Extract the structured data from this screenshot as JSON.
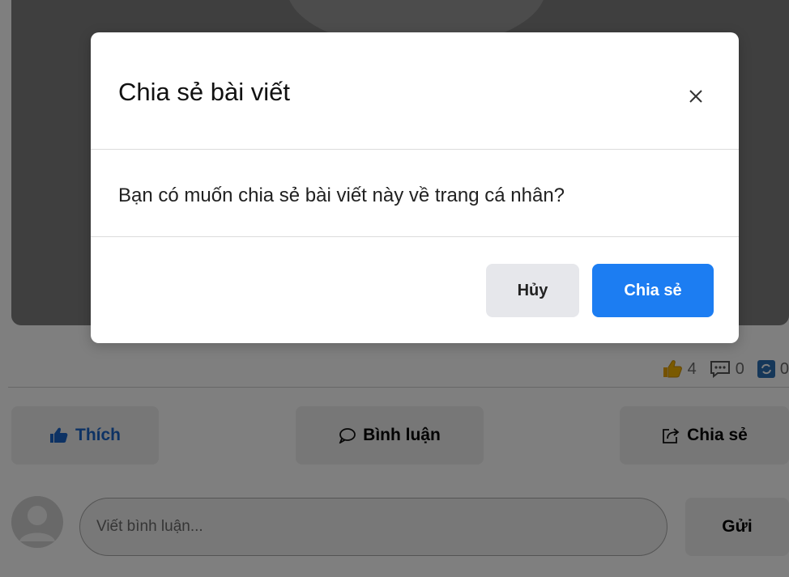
{
  "post": {
    "stats": {
      "likes": "4",
      "comments": "0",
      "shares": "0"
    },
    "actions": {
      "like_label": "Thích",
      "comment_label": "Bình luận",
      "share_label": "Chia sẻ"
    },
    "comment_box": {
      "placeholder": "Viết bình luận...",
      "value": "",
      "send_label": "Gửi"
    }
  },
  "modal": {
    "title": "Chia sẻ bài viết",
    "message": "Bạn có muốn chia sẻ bài viết này về trang cá nhân?",
    "cancel_label": "Hủy",
    "confirm_label": "Chia sẻ"
  },
  "icons": {
    "like_stat": "thumbs-up-icon",
    "comment_stat": "comment-icon",
    "share_stat": "share-icon",
    "like_action": "thumbs-up-icon",
    "comment_action": "speech-bubble-icon",
    "share_action": "share-arrow-icon",
    "close": "close-icon",
    "avatar": "default-avatar-icon"
  },
  "colors": {
    "primary": "#1c7df2",
    "like_text": "#1a64c8",
    "like_stat_icon": "#f4b400",
    "overlay": "rgba(0,0,0,0.5)"
  }
}
